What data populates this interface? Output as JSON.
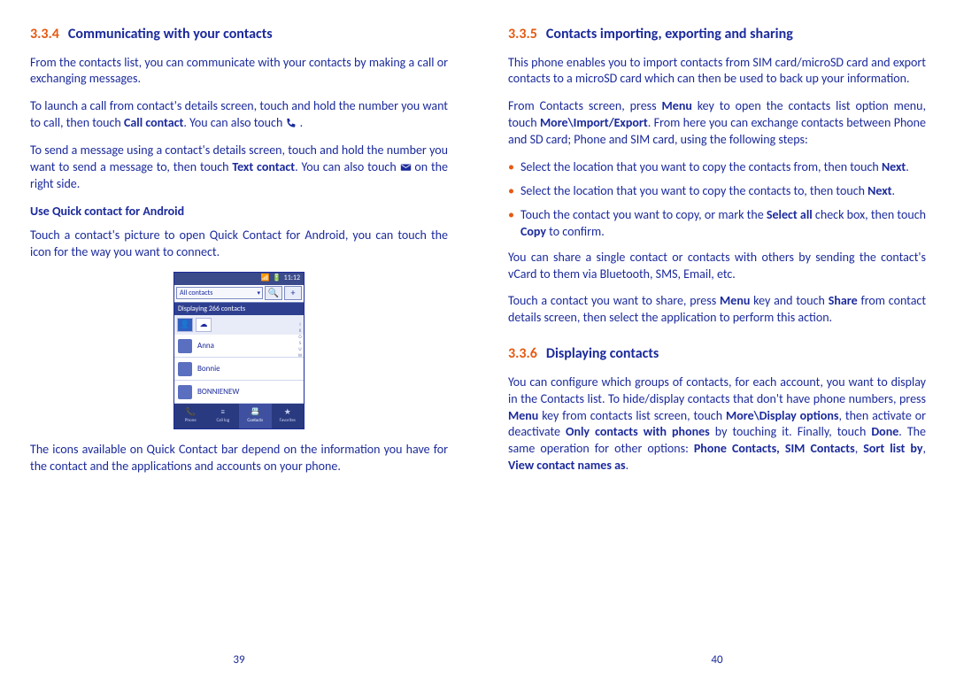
{
  "left": {
    "sec_num": "3.3.4",
    "sec_title": "Communicating with your contacts",
    "p1": "From the contacts list, you can communicate with your contacts by making a call or exchanging messages.",
    "p2a": "To launch a call from contact's details screen, touch and hold the number you want to call, then touch ",
    "p2_bold": "Call contact",
    "p2b": ". You can also touch ",
    "p2c": " .",
    "p3a": "To send a message using a contact's details screen, touch and hold the number you want to send a message to, then touch ",
    "p3_bold": "Text contact",
    "p3b": ". You can also touch ",
    "p3c": " on the right side.",
    "sub1": "Use Quick contact for Android",
    "p4": "Touch a contact's picture to open Quick Contact for Android, you can touch the icon for the way you want to connect.",
    "p5": "The icons available on Quick Contact bar depend on the information you have for the contact and the applications and accounts on your phone.",
    "pagenum": "39",
    "mock": {
      "time": "11:12",
      "dropdown": "All contacts",
      "search_icon": "🔍",
      "add_icon": "+",
      "count": "Displaying 266 contacts",
      "rows": [
        "Anna",
        "Bonnie",
        "BONNIENEW"
      ],
      "tabs": [
        "Phone",
        "Call log",
        "Contacts",
        "Favorites"
      ]
    }
  },
  "right": {
    "sec_num": "3.3.5",
    "sec_title": "Contacts importing, exporting and sharing",
    "p1": "This phone enables you to import contacts from SIM card/microSD card and export contacts to a microSD card which can then be used to back up your information.",
    "p2a": "From Contacts screen, press ",
    "p2_menu": "Menu",
    "p2b": " key to open the  contacts list option menu, touch ",
    "p2_more": "More\\Import/Export",
    "p2c": ". From here you can exchange contacts between Phone and SD card;  Phone and SIM card, using the following steps:",
    "li1a": "Select the location that you want to copy the contacts from, then touch ",
    "li1_next": "Next",
    "li1b": ".",
    "li2a": "Select the location that you want to copy the contacts to, then touch ",
    "li2_next": "Next",
    "li2b": ".",
    "li3a": "Touch the contact you want to copy, or mark the ",
    "li3_sel": "Select all",
    "li3b": " check box, then touch ",
    "li3_copy": "Copy",
    "li3c": " to confirm.",
    "p3": "You can share a single contact or contacts with others by sending the contact's vCard to them via Bluetooth, SMS, Email, etc.",
    "p4a": "Touch a contact you want to share, press ",
    "p4_menu": "Menu",
    "p4b": " key and touch ",
    "p4_share": "Share",
    "p4c": " from contact details screen, then select the application to perform this action.",
    "sec2_num": "3.3.6",
    "sec2_title": "Displaying contacts",
    "p5a": "You can configure which groups of contacts, for each account, you want to display in the Contacts list. To hide/display contacts that don't have phone numbers, press ",
    "p5_menu": "Menu",
    "p5b": " key from contacts list screen, touch ",
    "p5_more": "More\\Display options",
    "p5c": ", then activate or deactivate ",
    "p5_only": "Only contacts with phones",
    "p5d": " by touching it. Finally, touch ",
    "p5_done": "Done",
    "p5e": ". The same operation for other options: ",
    "p5_list": "Phone Contacts, SIM Contacts",
    "p5f": ", ",
    "p5_sort": "Sort list by",
    "p5g": ", ",
    "p5_view": "View contact names as",
    "p5h": ".",
    "pagenum": "40"
  }
}
